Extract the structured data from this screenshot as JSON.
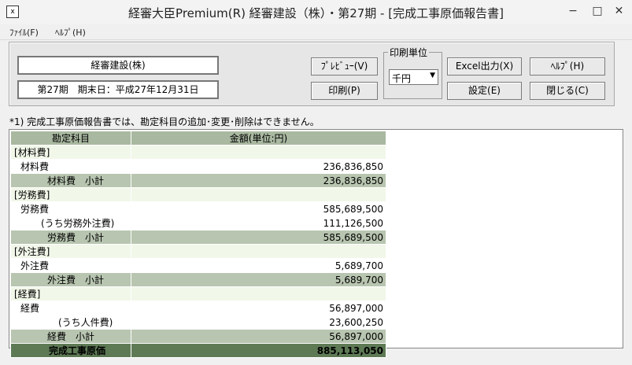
{
  "window": {
    "title": "経審大臣Premium(R) 経審建設（株）・第27期 - [完成工事原価報告書]",
    "icon_text": "x",
    "min": "−",
    "max": "□",
    "close": "✕"
  },
  "menu": {
    "file": "ﾌｧｲﾙ(F)",
    "help": "ﾍﾙﾌﾟ(H)"
  },
  "header": {
    "company": "経審建設(株)",
    "period": "第27期　期末日：平成27年12月31日"
  },
  "buttons": {
    "preview": "ﾌﾟﾚﾋﾞｭｰ(V)",
    "print": "印刷(P)",
    "excel": "Excel出力(X)",
    "settings": "設定(E)",
    "help": "ﾍﾙﾌﾟ(H)",
    "close": "閉じる(C)"
  },
  "unit": {
    "legend": "印刷単位",
    "value": "千円"
  },
  "note": "*1) 完成工事原価報告書では、勘定科目の追加･変更･削除はできません。",
  "table": {
    "headers": [
      "勘定科目",
      "金額(単位:円)"
    ],
    "rows": [
      {
        "type": "cat",
        "label": "[材料費]",
        "amount": ""
      },
      {
        "type": "item",
        "label": "材料費",
        "amount": "236,836,850"
      },
      {
        "type": "sub",
        "label": "材料費　小計",
        "amount": "236,836,850"
      },
      {
        "type": "cat",
        "label": "[労務費]",
        "amount": ""
      },
      {
        "type": "item",
        "label": "労務費",
        "amount": "585,689,500"
      },
      {
        "type": "item2",
        "label": "(うち労務外注費)",
        "amount": "111,126,500"
      },
      {
        "type": "sub",
        "label": "労務費　小計",
        "amount": "585,689,500"
      },
      {
        "type": "cat",
        "label": "[外注費]",
        "amount": ""
      },
      {
        "type": "item",
        "label": "外注費",
        "amount": "5,689,700"
      },
      {
        "type": "sub",
        "label": "外注費　小計",
        "amount": "5,689,700"
      },
      {
        "type": "cat",
        "label": "[経費]",
        "amount": ""
      },
      {
        "type": "item",
        "label": "経費",
        "amount": "56,897,000"
      },
      {
        "type": "item3",
        "label": "(うち人件費)",
        "amount": "23,600,250"
      },
      {
        "type": "sub",
        "label": "経費　小計",
        "amount": "56,897,000"
      },
      {
        "type": "total",
        "label": "完成工事原価",
        "amount": "885,113,050"
      }
    ]
  }
}
